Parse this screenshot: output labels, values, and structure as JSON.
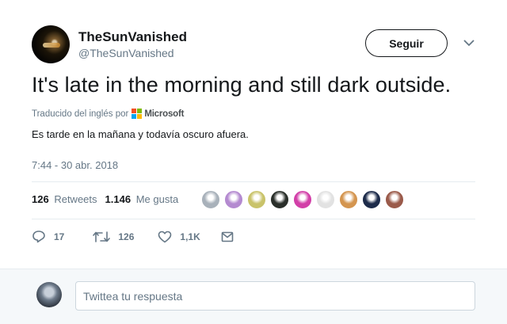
{
  "tweet": {
    "display_name": "TheSunVanished",
    "handle": "@TheSunVanished",
    "follow_label": "Seguir",
    "text": "It's late in the morning and still dark outside.",
    "translated_from": "Traducido del inglés por",
    "translator": "Microsoft",
    "translation": "Es tarde en la mañana y todavía oscuro afuera.",
    "timestamp": "7:44 - 30 abr. 2018"
  },
  "stats": {
    "retweets_count": "126",
    "retweets_label": "Retweets",
    "likes_count": "1.146",
    "likes_label": "Me gusta"
  },
  "liker_avatars": [
    {
      "icon": "default-avatar",
      "color": "#a8b1ba"
    },
    {
      "icon": "cartoon-avatar",
      "color": "#b48ad0"
    },
    {
      "icon": "alien-avatar",
      "color": "#c9c36a"
    },
    {
      "icon": "character-avatar",
      "color": "#2a2f2a"
    },
    {
      "icon": "colorful-avatar",
      "color": "#d23fa8"
    },
    {
      "icon": "logo-avatar",
      "color": "#e2e2e2"
    },
    {
      "icon": "portrait-avatar",
      "color": "#d4954f"
    },
    {
      "icon": "dark-avatar",
      "color": "#1d2b4a"
    },
    {
      "icon": "photo-avatar",
      "color": "#9a5a4a"
    }
  ],
  "actions": {
    "replies": "17",
    "retweets": "126",
    "likes": "1,1K"
  },
  "reply": {
    "placeholder": "Twittea tu respuesta"
  },
  "colors": {
    "text_primary": "#14171a",
    "text_secondary": "#657786",
    "divider": "#e6ecf0",
    "reply_bg": "#f5f8fa"
  }
}
